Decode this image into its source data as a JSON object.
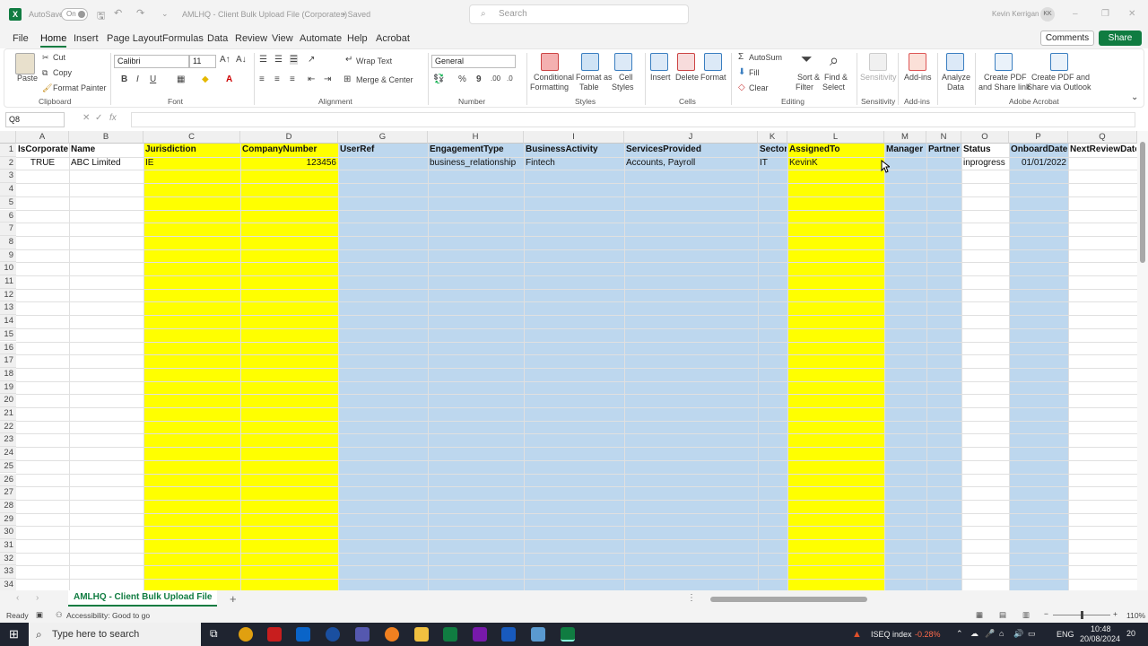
{
  "window": {
    "autosave_label": "AutoSave",
    "autosave_state": "On",
    "document_title": "AMLHQ - Client Bulk Upload File (Corporates)",
    "save_status": "• Saved",
    "search_placeholder": "Search",
    "user_name": "Kevin Kerrigan",
    "user_initials": "KK"
  },
  "menu": {
    "tabs": [
      "File",
      "Home",
      "Insert",
      "Page Layout",
      "Formulas",
      "Data",
      "Review",
      "View",
      "Automate",
      "Help",
      "Acrobat"
    ],
    "active_tab": "Home",
    "comments_label": "Comments",
    "share_label": "Share"
  },
  "ribbon": {
    "clipboard": {
      "paste": "Paste",
      "cut": "Cut",
      "copy": "Copy",
      "format_painter": "Format Painter",
      "group": "Clipboard"
    },
    "font": {
      "family": "Calibri",
      "size": "11",
      "group": "Font"
    },
    "alignment": {
      "wrap": "Wrap Text",
      "merge": "Merge & Center",
      "group": "Alignment"
    },
    "number": {
      "format": "General",
      "group": "Number"
    },
    "styles": {
      "conditional": [
        "Conditional",
        "Formatting"
      ],
      "format_table": [
        "Format as",
        "Table"
      ],
      "cell_styles": [
        "Cell",
        "Styles"
      ],
      "group": "Styles"
    },
    "cells": {
      "insert": "Insert",
      "delete": "Delete",
      "format": "Format",
      "group": "Cells"
    },
    "editing": {
      "autosum": "AutoSum",
      "fill": "Fill",
      "clear": "Clear",
      "sort": [
        "Sort &",
        "Filter"
      ],
      "find": [
        "Find &",
        "Select"
      ],
      "group": "Editing"
    },
    "sensitivity": {
      "label": "Sensitivity",
      "group": "Sensitivity"
    },
    "addins": {
      "label": "Add-ins",
      "group": "Add-ins"
    },
    "analyze": {
      "label": [
        "Analyze",
        "Data"
      ]
    },
    "acrobat": {
      "create_pdf": [
        "Create PDF",
        "and Share link"
      ],
      "create_outlook": [
        "Create PDF and",
        "Share via Outlook"
      ],
      "group": "Adobe Acrobat"
    }
  },
  "formula_bar": {
    "name_box": "Q8",
    "fx": "fx",
    "value": ""
  },
  "sheet": {
    "columns": [
      "A",
      "B",
      "C",
      "D",
      "G",
      "H",
      "I",
      "J",
      "K",
      "L",
      "M",
      "N",
      "O",
      "P",
      "Q"
    ],
    "row_numbers": [
      "1",
      "2",
      "3",
      "4",
      "5",
      "6",
      "7",
      "8",
      "9",
      "10",
      "11",
      "12",
      "13",
      "14",
      "15",
      "16",
      "17",
      "18",
      "19",
      "20",
      "21",
      "22",
      "23",
      "24",
      "25",
      "26",
      "27",
      "28",
      "29",
      "30",
      "31",
      "32",
      "33",
      "34"
    ],
    "headers": [
      "IsCorporate",
      "Name",
      "Jurisdiction",
      "CompanyNumber",
      "UserRef",
      "EngagementType",
      "BusinessActivity",
      "ServicesProvided",
      "Sector",
      "AssignedTo",
      "Manager",
      "Partner",
      "Status",
      "OnboardDate",
      "NextReviewDate"
    ],
    "row2": [
      "TRUE",
      "ABC Limited",
      "IE",
      "123456",
      "",
      "business_relationship",
      "Fintech",
      "Accounts, Payroll",
      "IT",
      "KevinK",
      "",
      "",
      "inprogress",
      "01/01/2022",
      ""
    ],
    "tab_name": "AMLHQ - Client Bulk Upload File",
    "colors": {
      "yellow": "#ffff00",
      "blue": "#bdd7ee"
    }
  },
  "status": {
    "ready": "Ready",
    "accessibility": "Accessibility: Good to go",
    "zoom": "110%"
  },
  "taskbar": {
    "search_placeholder": "Type here to search",
    "ticker": "ISEQ index",
    "ticker_change": "-0.28%",
    "lang": "ENG",
    "time": "10:48",
    "date": "20/08/2024",
    "notifications": "20"
  }
}
